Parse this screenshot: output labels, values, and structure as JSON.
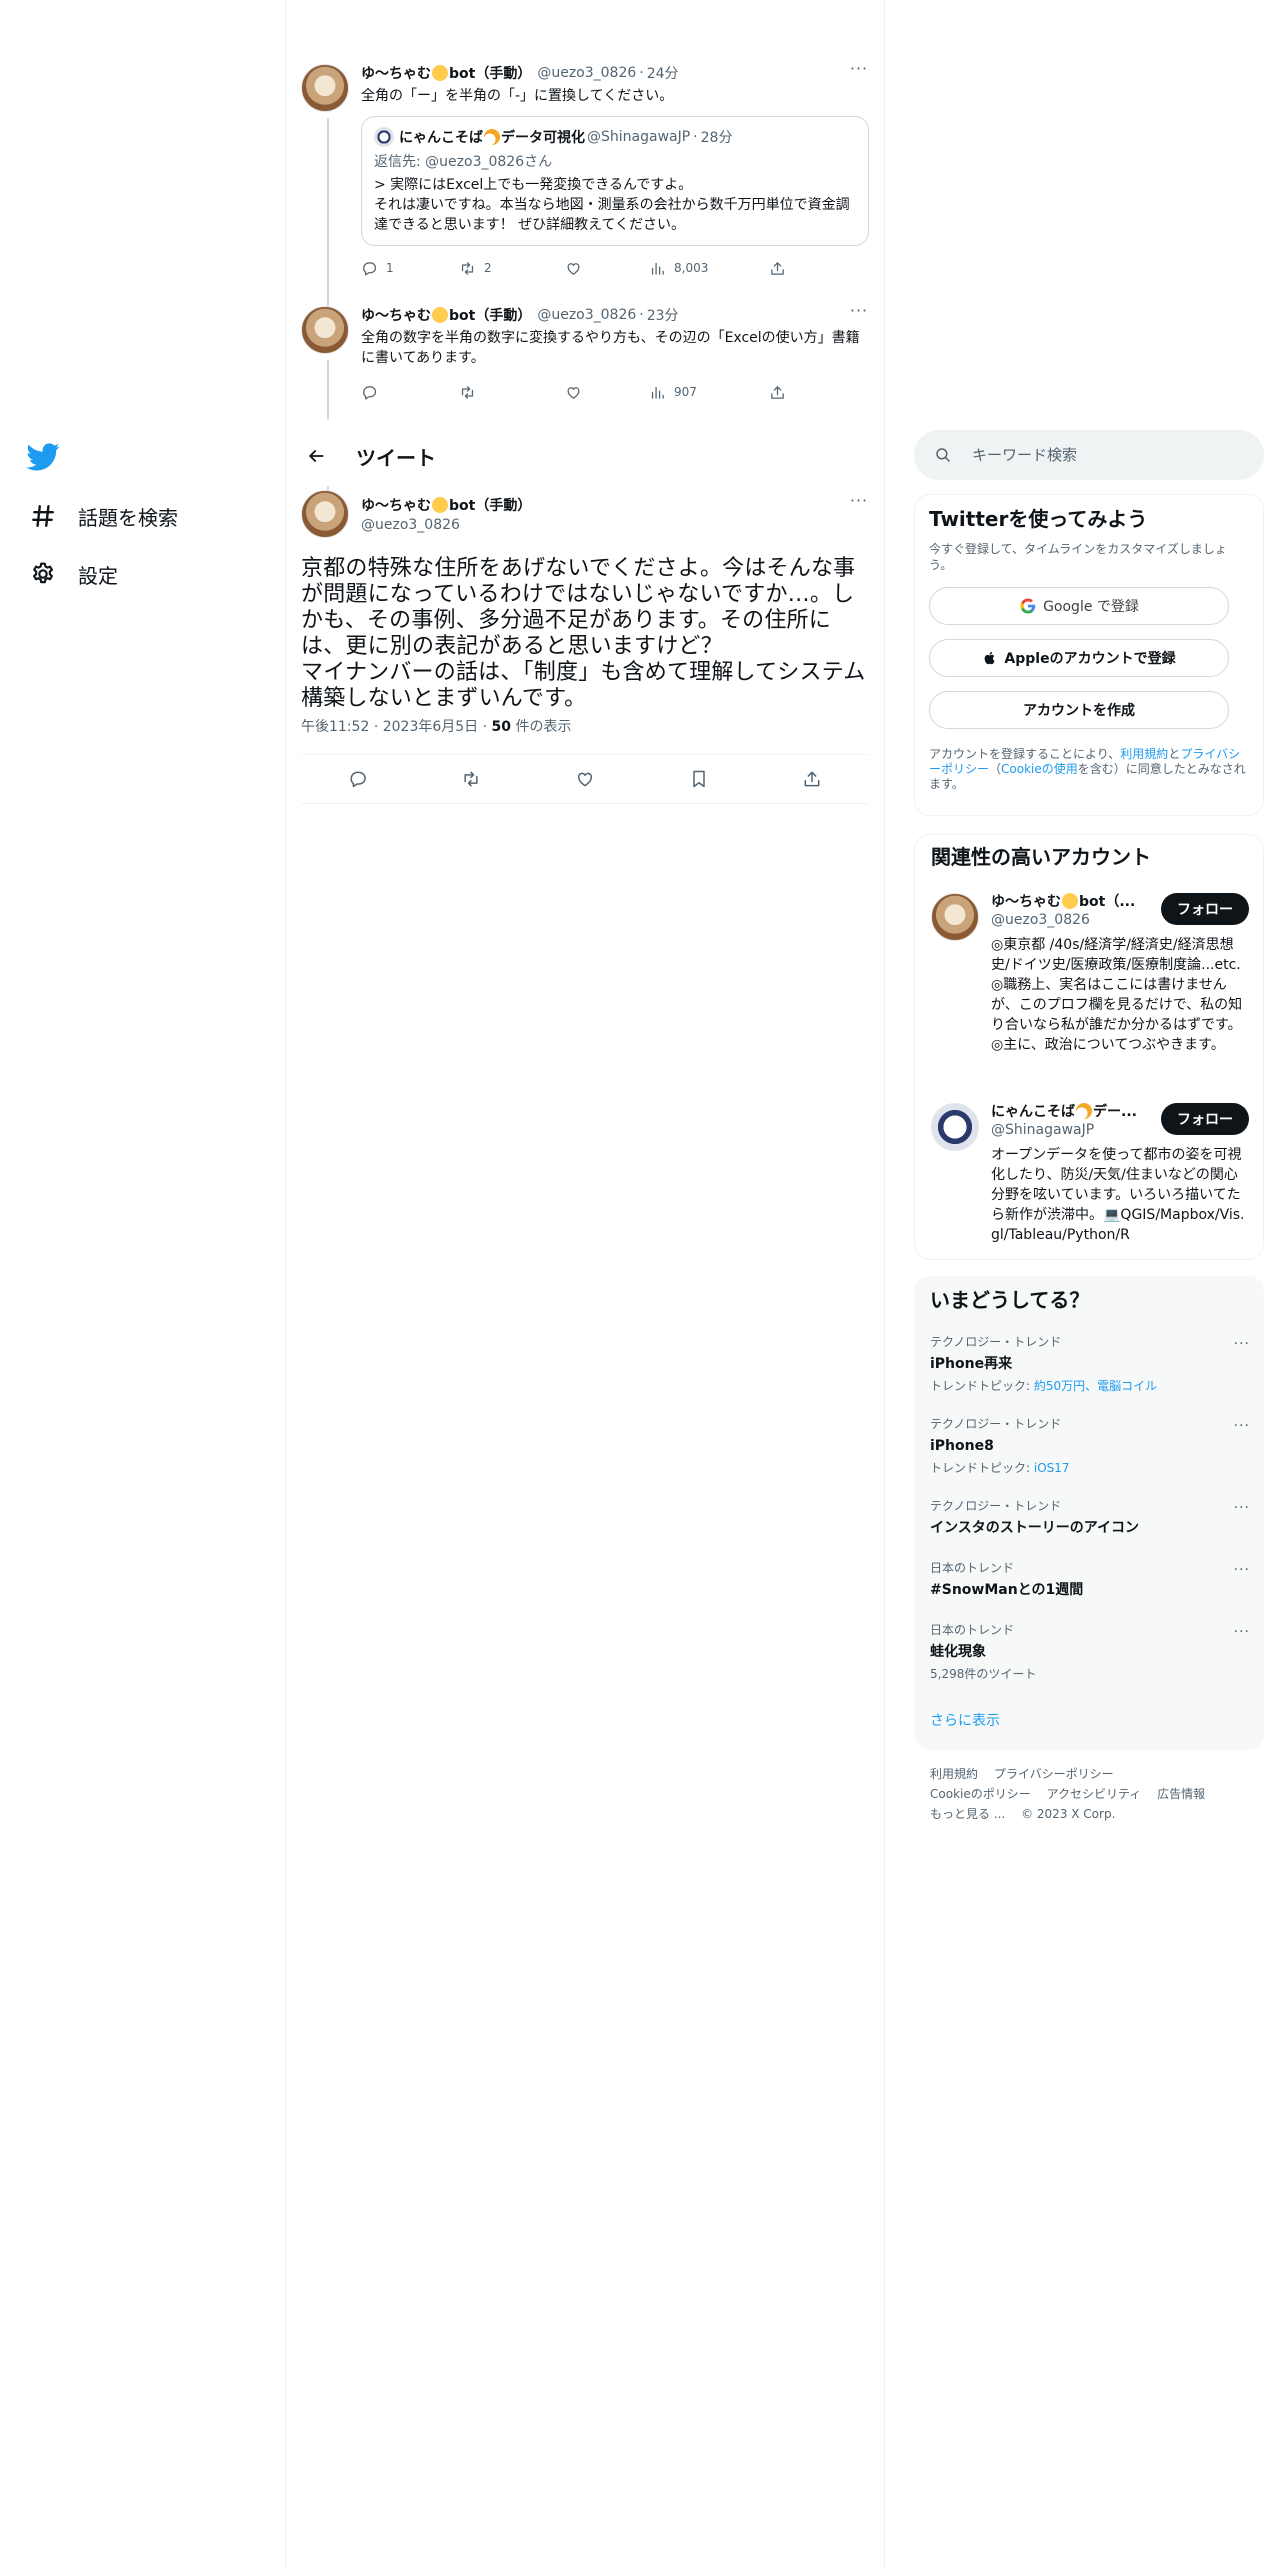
{
  "nav": {
    "explore_label": "話題を検索",
    "settings_label": "設定"
  },
  "thread": {
    "tweet1": {
      "name": "ゆ〜ちゃむ",
      "name_suffix": "bot（手動）",
      "handle": "@uezo3_0826",
      "time": "24分",
      "text": "全角の「ー」を半角の「-」に置換してください。",
      "quote": {
        "name": "にゃんこそば",
        "name_suffix": "データ可視化",
        "handle": "@ShinagawaJP",
        "time": "28分",
        "reply_to": "返信先: @uezo3_0826さん",
        "text": "> 実際にはExcel上でも一発変換できるんですよ。\nそれは凄いですね。本当なら地図・測量系の会社から数千万円単位で資金調達できると思います！ ぜひ詳細教えてください。"
      },
      "replies": "1",
      "retweets": "2",
      "likes": "",
      "views": "8,003"
    },
    "tweet2": {
      "name": "ゆ〜ちゃむ",
      "name_suffix": "bot（手動）",
      "handle": "@uezo3_0826",
      "time": "23分",
      "text": "全角の数字を半角の数字に変換するやり方も、その辺の「Excelの使い方」書籍に書いてあります。",
      "views": "907"
    }
  },
  "header": {
    "title": "ツイート"
  },
  "main_tweet": {
    "name": "ゆ〜ちゃむ",
    "name_suffix": "bot（手動）",
    "handle": "@uezo3_0826",
    "text": "京都の特殊な住所をあげないでくださよ。今はそんな事が問題になっているわけではないじゃないですか…。しかも、その事例、多分過不足があります。その住所には、更に別の表記があると思いますけど？\nマイナンバーの話は、「制度」も含めて理解してシステム構築しないとまずいんです。",
    "time": "午後11:52",
    "date": "2023年6月5日",
    "views_count": "50",
    "views_label": " 件の表示"
  },
  "search": {
    "placeholder": "キーワード検索"
  },
  "signup": {
    "title": "Twitterを使ってみよう",
    "subtitle": "今すぐ登録して、タイムラインをカスタマイズしましょう。",
    "google_label": "Google で登録",
    "apple_label": "Appleのアカウントで登録",
    "create_label": "アカウントを作成",
    "legal_prefix": "アカウントを登録することにより、",
    "legal_terms": "利用規約",
    "legal_and": "と",
    "legal_privacy": "プライバシーポリシー",
    "legal_paren_open": "（",
    "legal_cookie": "Cookieの使用",
    "legal_suffix": "を含む）に同意したとみなされます。"
  },
  "related": {
    "title": "関連性の高いアカウント",
    "accounts": [
      {
        "name": "ゆ〜ちゃむ",
        "name_suffix": "bot（...",
        "handle": "@uezo3_0826",
        "bio": "◎東京都 /40s/経済学/経済史/経済思想史/ドイツ史/医療政策/医療制度論...etc. ◎職務上、実名はここには書けませんが、このプロフ欄を見るだけで、私の知り合いなら私が誰だか分かるはずです。◎主に、政治についてつぶやきます。",
        "follow_label": "フォロー"
      },
      {
        "name": "にゃんこそば",
        "name_suffix": "デー...",
        "handle": "@ShinagawaJP",
        "bio": "オープンデータを使って都市の姿を可視化したり、防災/天気/住まいなどの関心分野を呟いています。いろいろ描いてたら新作が渋滞中。💻QGIS/Mapbox/Vis.gl/Tableau/Python/R",
        "follow_label": "フォロー"
      }
    ]
  },
  "trends": {
    "title": "いまどうしてる？",
    "items": [
      {
        "category": "テクノロジー・トレンド",
        "name": "iPhone再来",
        "topic_prefix": "トレンドトピック: ",
        "topic": "約50万円、電脳コイル",
        "count": ""
      },
      {
        "category": "テクノロジー・トレンド",
        "name": "iPhone8",
        "topic_prefix": "トレンドトピック: ",
        "topic": "iOS17",
        "count": ""
      },
      {
        "category": "テクノロジー・トレンド",
        "name": "インスタのストーリーのアイコン",
        "topic_prefix": "",
        "topic": "",
        "count": ""
      },
      {
        "category": "日本のトレンド",
        "name": "#SnowManとの1週間",
        "topic_prefix": "",
        "topic": "",
        "count": ""
      },
      {
        "category": "日本のトレンド",
        "name": "蛙化現象",
        "topic_prefix": "",
        "topic": "",
        "count": "5,298件のツイート"
      }
    ],
    "show_more": "さらに表示"
  },
  "footer": {
    "links": [
      "利用規約",
      "プライバシーポリシー",
      "Cookieのポリシー",
      "アクセシビリティ",
      "広告情報",
      "もっと見る ..."
    ],
    "copyright": "© 2023 X Corp."
  },
  "colors": {
    "accent": "#1d9bf0",
    "text": "#0f1419",
    "muted": "#536471",
    "border": "#eff3f4"
  },
  "icons": [
    "twitter-bird-icon",
    "hashtag-icon",
    "gear-icon",
    "back-arrow-icon",
    "search-icon",
    "reply-icon",
    "retweet-icon",
    "like-icon",
    "views-icon",
    "share-icon",
    "bookmark-icon",
    "google-icon",
    "apple-icon"
  ]
}
